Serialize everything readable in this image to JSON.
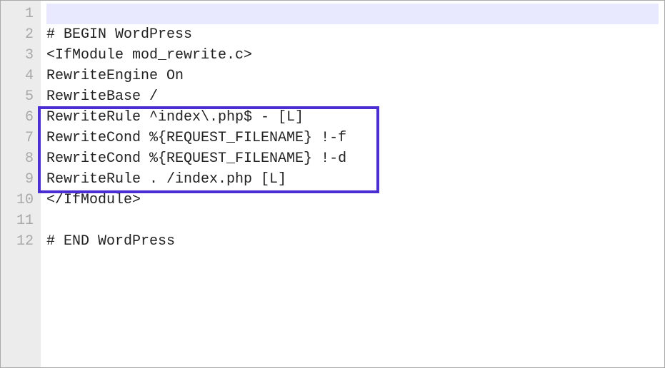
{
  "lines": {
    "l1": "",
    "l2": "# BEGIN WordPress",
    "l3": "<IfModule mod_rewrite.c>",
    "l4": "RewriteEngine On",
    "l5": "RewriteBase /",
    "l6": "RewriteRule ^index\\.php$ - [L]",
    "l7": "RewriteCond %{REQUEST_FILENAME} !-f",
    "l8": "RewriteCond %{REQUEST_FILENAME} !-d",
    "l9": "RewriteRule . /index.php [L]",
    "l10": "</IfModule>",
    "l11": "",
    "l12": "# END WordPress"
  },
  "line_numbers": {
    "n1": "1",
    "n2": "2",
    "n3": "3",
    "n4": "4",
    "n5": "5",
    "n6": "6",
    "n7": "7",
    "n8": "8",
    "n9": "9",
    "n10": "10",
    "n11": "11",
    "n12": "12"
  }
}
